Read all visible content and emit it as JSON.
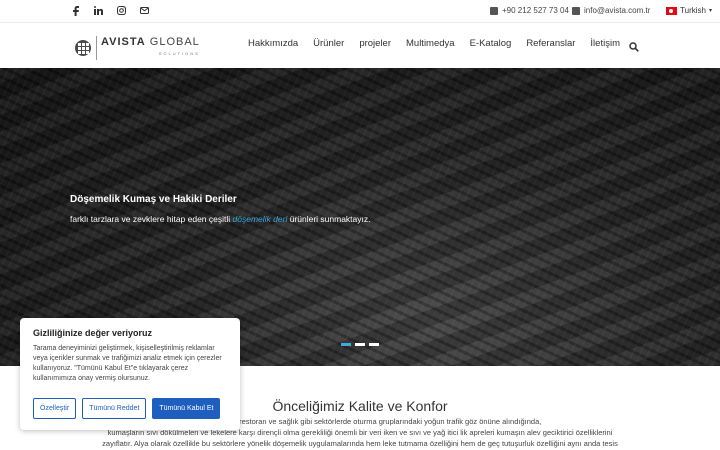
{
  "topbar": {
    "social": [
      "facebook-icon",
      "linkedin-icon",
      "instagram-icon",
      "mail-icon"
    ],
    "phone": "+90 212 527 73 04",
    "email": "info@avista.com.tr",
    "language": "Turkish"
  },
  "header": {
    "logo_main": "AVISTA",
    "logo_second": "GLOBAL",
    "logo_sub": "SOLUTIONS",
    "nav": [
      "Hakkımızda",
      "Ürünler",
      "projeler",
      "Multimedya",
      "E-Katalog",
      "Referanslar",
      "İletişim"
    ]
  },
  "hero": {
    "title": "Döşemelik Kumaş ve Hakiki Deriler",
    "text_before": "farklı tarzlara ve zevklere hitap eden çeşitli ",
    "highlight": "döşemelik deri",
    "text_after": " ürünleri sunmaktayız.",
    "slides": 3,
    "active_slide": 1
  },
  "section": {
    "title": "Önceliğimiz Kalite ve Konfor",
    "line1": "e Tutmazlık: Otel, restoran ve sağlık gibi sektörlerde oturma gruplarındaki yoğun trafik göz önüne alındığında,",
    "line2": "kumaşların sıvı dökülmeleri ve lekelere karşı dirençli olma gerekliliği önemli bir veri iken ve sıvı ve yağ itici lik apreleri kumaşın alev geciktirici özelliklerini",
    "line3": "zayıflatır. Alya olarak özellikle bu sektörlere yönelik döşemelik uygulamalarında hem leke tutmama özelliğini hem de geç tutuşurluk özelliğini aynı anda tesis"
  },
  "cookie": {
    "title": "Gizliliğinize değer veriyoruz",
    "text": "Tarama deneyiminizi geliştirmek, kişiselleştirilmiş reklamlar veya içerikler sunmak ve trafiğimizi analiz etmek için çerezler kullanıyoruz. \"Tümünü Kabul Et\"e tıklayarak çerez kullanımımıza onay vermiş olursunuz.",
    "customize": "Özelleştir",
    "reject": "Tümünü Reddet",
    "accept": "Tümünü Kabul Et"
  },
  "colors": {
    "accent": "#3ea9e0",
    "button": "#1d5ebf"
  }
}
